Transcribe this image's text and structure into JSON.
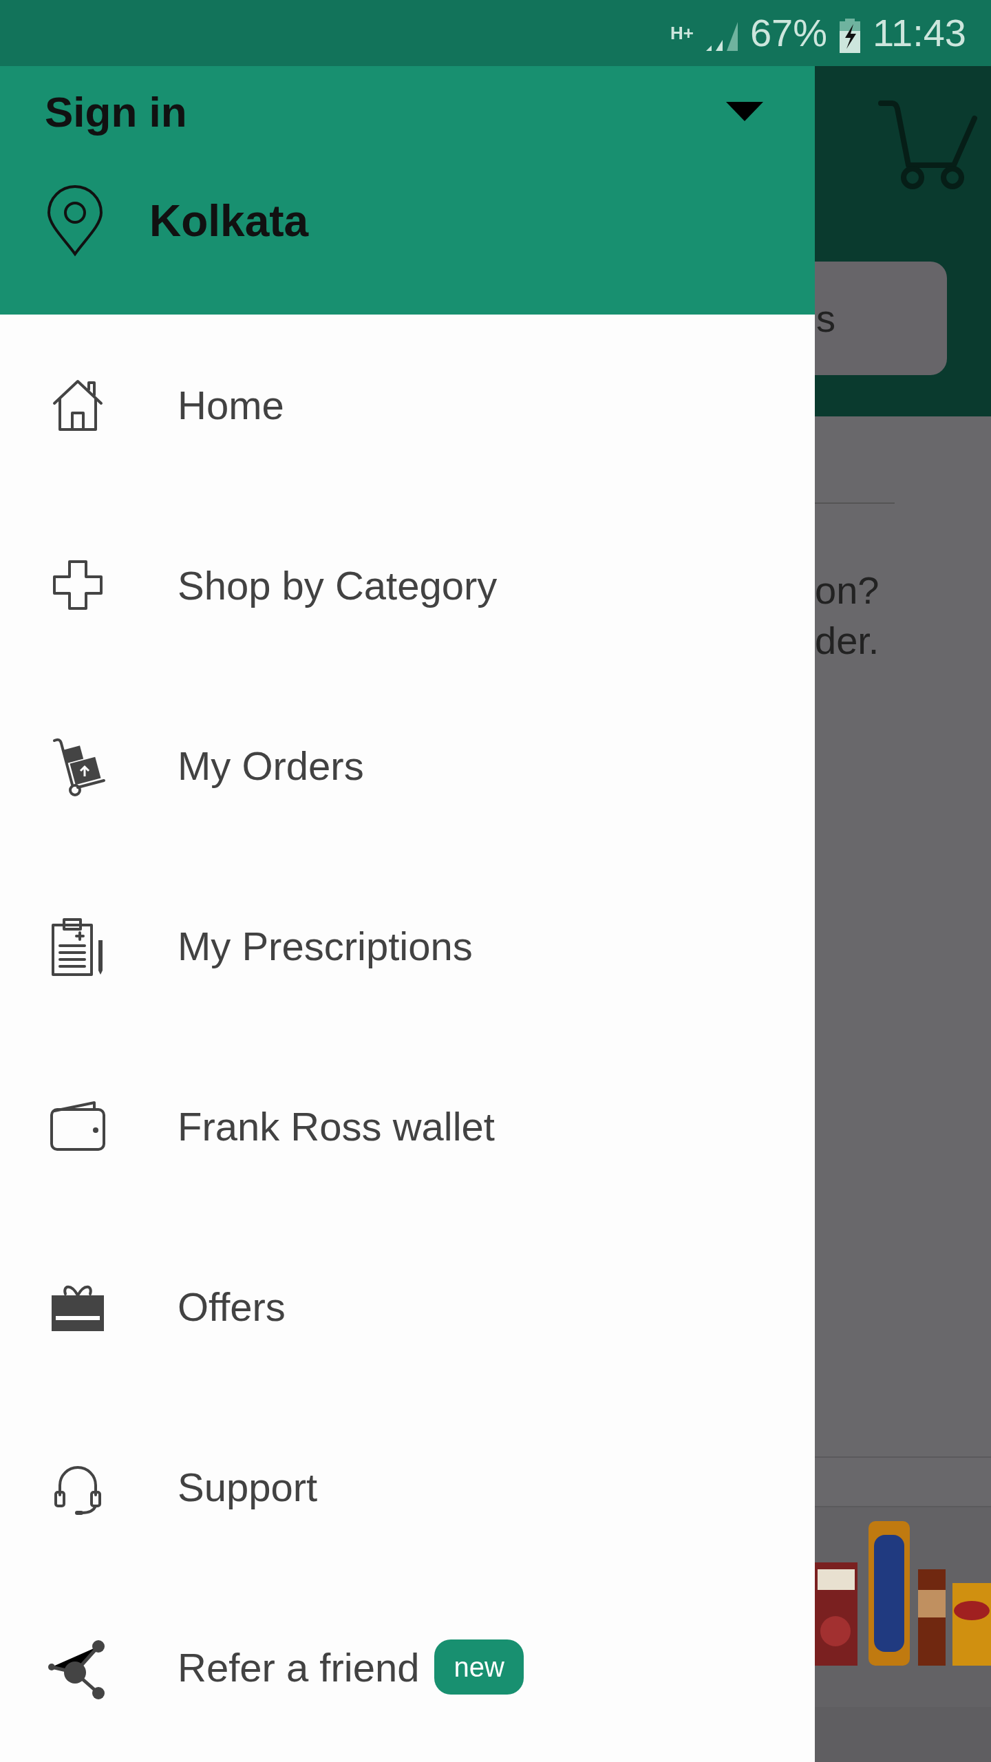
{
  "status_bar": {
    "network": "H+",
    "battery": "67%",
    "time": "11:43"
  },
  "drawer": {
    "account": "Sign in",
    "location": "Kolkata",
    "items": [
      {
        "label": "Home"
      },
      {
        "label": "Shop by Category"
      },
      {
        "label": "My Orders"
      },
      {
        "label": "My Prescriptions"
      },
      {
        "label": "Frank Ross wallet"
      },
      {
        "label": "Offers"
      },
      {
        "label": "Support"
      },
      {
        "label": "Refer a friend",
        "badge": "new"
      }
    ]
  },
  "background": {
    "search_text": "s",
    "prompt_lines": [
      "on?",
      "der."
    ]
  }
}
